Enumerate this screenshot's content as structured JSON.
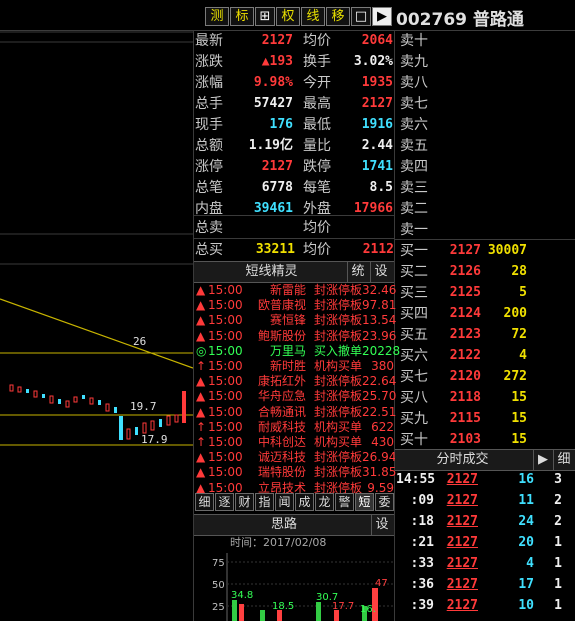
{
  "toolbar": {
    "buttons": [
      "测",
      "标",
      "⊞",
      "权",
      "线",
      "移",
      "□",
      "▶"
    ],
    "title": "002769 普路通"
  },
  "quote": {
    "rows": [
      {
        "l1": "最新",
        "v1": "2127",
        "c1": "red",
        "l2": "均价",
        "v2": "2064",
        "c2": "red"
      },
      {
        "l1": "涨跌",
        "v1": "▲193",
        "c1": "red",
        "l2": "换手",
        "v2": "3.02%",
        "c2": "white"
      },
      {
        "l1": "涨幅",
        "v1": "9.98%",
        "c1": "red",
        "l2": "今开",
        "v2": "1935",
        "c2": "red"
      },
      {
        "l1": "总手",
        "v1": "57427",
        "c1": "white",
        "l2": "最高",
        "v2": "2127",
        "c2": "red"
      },
      {
        "l1": "现手",
        "v1": "176",
        "c1": "cyan",
        "l2": "最低",
        "v2": "1916",
        "c2": "cyan"
      },
      {
        "l1": "总额",
        "v1": "1.19亿",
        "c1": "white",
        "l2": "量比",
        "v2": "2.44",
        "c2": "white"
      },
      {
        "l1": "涨停",
        "v1": "2127",
        "c1": "red",
        "l2": "跌停",
        "v2": "1741",
        "c2": "cyan"
      },
      {
        "l1": "总笔",
        "v1": "6778",
        "c1": "white",
        "l2": "每笔",
        "v2": "8.5",
        "c2": "white"
      },
      {
        "l1": "内盘",
        "v1": "39461",
        "c1": "cyan",
        "l2": "外盘",
        "v2": "17966",
        "c2": "red"
      }
    ],
    "sell_total_label": "总卖",
    "sell_avg_label": "均价",
    "buy_total_label": "总买",
    "buy_total": "33211",
    "buy_avg_label": "均价",
    "buy_avg": "2112"
  },
  "asks": [
    "卖十",
    "卖九",
    "卖八",
    "卖七",
    "卖六",
    "卖五",
    "卖四",
    "卖三",
    "卖二",
    "卖一"
  ],
  "bids": [
    {
      "label": "买一",
      "price": "2127",
      "vol": "30007"
    },
    {
      "label": "买二",
      "price": "2126",
      "vol": "28"
    },
    {
      "label": "买三",
      "price": "2125",
      "vol": "5"
    },
    {
      "label": "买四",
      "price": "2124",
      "vol": "200"
    },
    {
      "label": "买五",
      "price": "2123",
      "vol": "72"
    },
    {
      "label": "买六",
      "price": "2122",
      "vol": "4"
    },
    {
      "label": "买七",
      "price": "2120",
      "vol": "272"
    },
    {
      "label": "买八",
      "price": "2118",
      "vol": "15"
    },
    {
      "label": "买九",
      "price": "2115",
      "vol": "15"
    },
    {
      "label": "买十",
      "price": "2103",
      "vol": "15"
    }
  ],
  "sprite": {
    "title": "短线精灵",
    "btn1": "统",
    "btn2": "设",
    "items": [
      {
        "icon": "▲",
        "time": "15:00",
        "name": "新雷能",
        "type": "封涨停板",
        "val": "32.46",
        "color": "red"
      },
      {
        "icon": "▲",
        "time": "15:00",
        "name": "欧普康视",
        "type": "封涨停板",
        "val": "97.81",
        "color": "red"
      },
      {
        "icon": "▲",
        "time": "15:00",
        "name": "赛恒锋",
        "type": "封涨停板",
        "val": "13.54",
        "color": "red"
      },
      {
        "icon": "▲",
        "time": "15:00",
        "name": "鲍斯股份",
        "type": "封涨停板",
        "val": "23.96",
        "color": "red"
      },
      {
        "icon": "◎",
        "time": "15:00",
        "name": "万里马",
        "type": "买入撤单",
        "val": "20228",
        "color": "green"
      },
      {
        "icon": "↑",
        "time": "15:00",
        "name": "新时胜",
        "type": "机构买单",
        "val": "380",
        "color": "red"
      },
      {
        "icon": "▲",
        "time": "15:00",
        "name": "康拓红外",
        "type": "封涨停板",
        "val": "22.64",
        "color": "red"
      },
      {
        "icon": "▲",
        "time": "15:00",
        "name": "华舟应急",
        "type": "封涨停板",
        "val": "25.70",
        "color": "red"
      },
      {
        "icon": "▲",
        "time": "15:00",
        "name": "合畅通讯",
        "type": "封涨停板",
        "val": "22.51",
        "color": "red"
      },
      {
        "icon": "↑",
        "time": "15:00",
        "name": "耐威科技",
        "type": "机构买单",
        "val": "622",
        "color": "red"
      },
      {
        "icon": "↑",
        "time": "15:00",
        "name": "中科创达",
        "type": "机构买单",
        "val": "430",
        "color": "red"
      },
      {
        "icon": "▲",
        "time": "15:00",
        "name": "诚迈科技",
        "type": "封涨停板",
        "val": "26.94",
        "color": "red"
      },
      {
        "icon": "▲",
        "time": "15:00",
        "name": "瑞特股份",
        "type": "封涨停板",
        "val": "31.85",
        "color": "red"
      },
      {
        "icon": "▲",
        "time": "15:00",
        "name": "立昂技术",
        "type": "封涨停板",
        "val": "9.59",
        "color": "red"
      }
    ],
    "tabs": [
      "细",
      "逐",
      "财",
      "指",
      "闻",
      "成",
      "龙",
      "警",
      "短",
      "委"
    ]
  },
  "thinking": {
    "title": "思路",
    "btn": "设",
    "time_label": "时间：2017/02/08",
    "axis": [
      "75",
      "50",
      "25"
    ],
    "bar_labels": [
      "34.8",
      "18.5",
      "30.7",
      "17.7",
      "16.",
      "47"
    ]
  },
  "ticks": {
    "title": "分时成交",
    "rows": [
      {
        "time": "14:55",
        "price": "2127",
        "vol": "16",
        "n": "3"
      },
      {
        "time": ":09",
        "price": "2127",
        "vol": "11",
        "n": "2"
      },
      {
        "time": ":18",
        "price": "2127",
        "vol": "24",
        "n": "2"
      },
      {
        "time": ":21",
        "price": "2127",
        "vol": "20",
        "n": "1"
      },
      {
        "time": ":33",
        "price": "2127",
        "vol": "4",
        "n": "1"
      },
      {
        "time": ":36",
        "price": "2127",
        "vol": "17",
        "n": "1"
      },
      {
        "time": ":39",
        "price": "2127",
        "vol": "10",
        "n": "1"
      }
    ]
  },
  "chart": {
    "label_a": "26",
    "label_b": "19.7",
    "label_c": "17.9"
  },
  "colors": {
    "up": "#ff3a3a",
    "down": "#40e0ff",
    "label": "#c8c8c8",
    "bg": "#000000"
  }
}
